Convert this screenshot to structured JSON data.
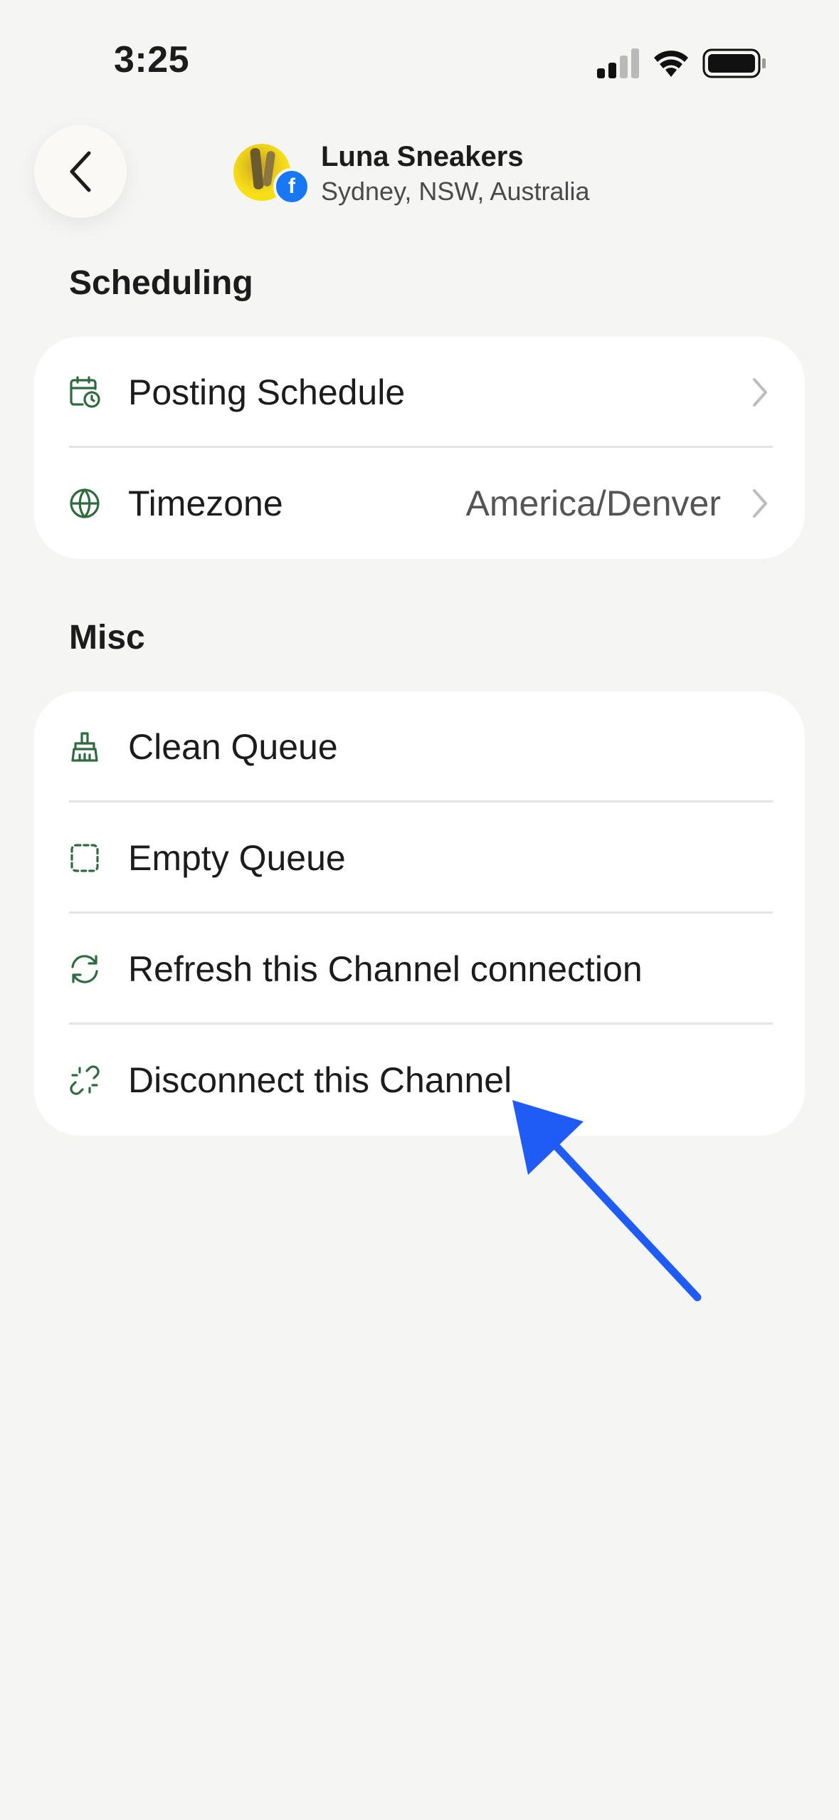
{
  "status_bar": {
    "time": "3:25"
  },
  "header": {
    "channel_name": "Luna Sneakers",
    "channel_location": "Sydney, NSW, Australia",
    "network_badge": "f"
  },
  "sections": {
    "scheduling": {
      "title": "Scheduling",
      "items": [
        {
          "label": "Posting Schedule",
          "icon": "calendar-clock-icon"
        },
        {
          "label": "Timezone",
          "value": "America/Denver",
          "icon": "globe-icon"
        }
      ]
    },
    "misc": {
      "title": "Misc",
      "items": [
        {
          "label": "Clean Queue",
          "icon": "broom-icon"
        },
        {
          "label": "Empty Queue",
          "icon": "dashed-square-icon"
        },
        {
          "label": "Refresh this Channel connection",
          "icon": "refresh-icon"
        },
        {
          "label": "Disconnect this Channel",
          "icon": "broken-link-icon"
        }
      ]
    }
  },
  "colors": {
    "background": "#f5f5f4",
    "card": "#ffffff",
    "icon_green": "#2f6b3f",
    "annotation_arrow": "#1f5cf6",
    "facebook_blue": "#1877f2"
  }
}
